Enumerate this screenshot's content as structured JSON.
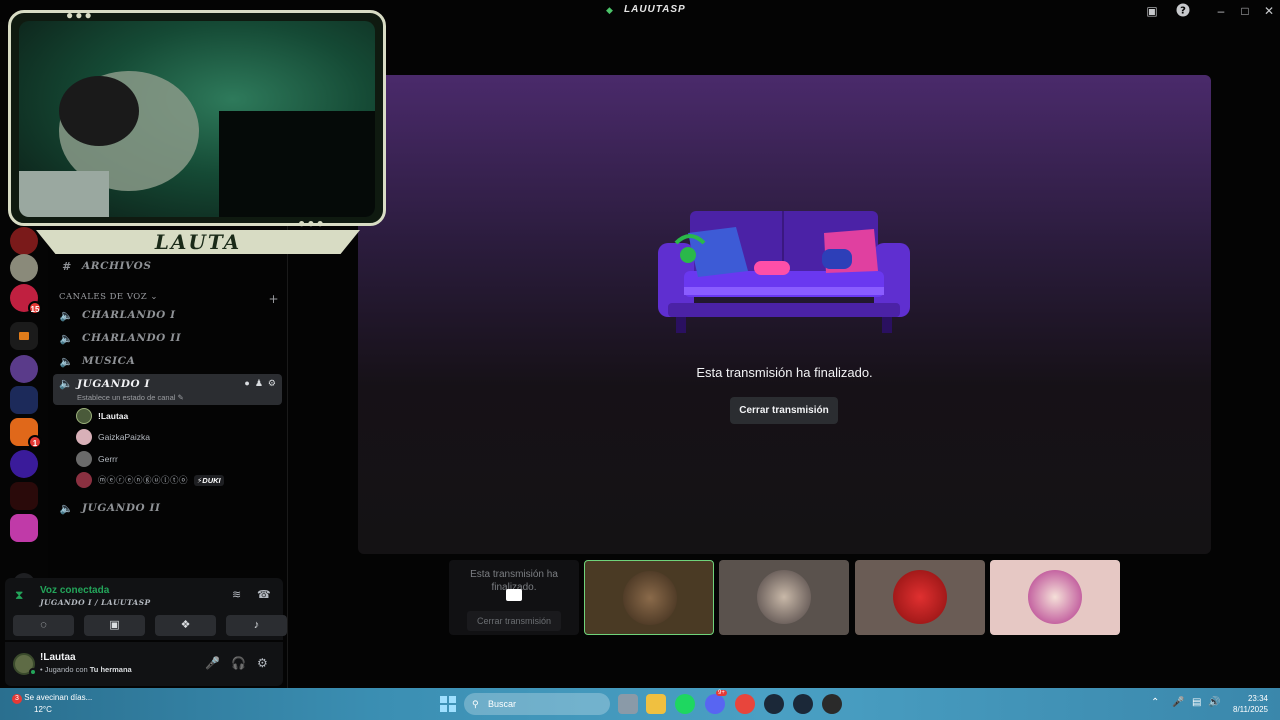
{
  "window": {
    "title": "LAUUTASP"
  },
  "webcam": {
    "name": "LAUTA"
  },
  "sidebar": {
    "top_channel": "ARCHIVOS",
    "voice_section": "CANALES DE VOZ",
    "voice_channels": [
      "CHARLANDO I",
      "CHARLANDO II",
      "MUSICA"
    ],
    "active_channel": {
      "name": "JUGANDO I",
      "status": "Establece un estado de canal"
    },
    "members": [
      "!Lautaa",
      "GaizkaPaizka",
      "Gerrr",
      "ⓜⓔⓡⓔⓝⓖⓤⓛⓣⓞ"
    ],
    "member_tag": "⚡DUKI",
    "other_channel": "JUGANDO II"
  },
  "server_badges": [
    "15",
    "1"
  ],
  "voice": {
    "title": "Voz conectada",
    "subtitle": "JUGANDO I / LAUUTASP"
  },
  "user": {
    "name": "!Lautaa",
    "status_prefix": "• Jugando con ",
    "status_game": "Tu hermana"
  },
  "stage": {
    "message": "Esta transmisión ha finalizado.",
    "close_button": "Cerrar transmisión"
  },
  "tiles": {
    "self_message": "Esta transmisión ha finalizado.",
    "self_button": "Cerrar transmisión"
  },
  "taskbar": {
    "weather_title": "Se avecinan días...",
    "weather_temp": "12°C",
    "weather_badge": "3",
    "search_placeholder": "Buscar",
    "discord_badge": "9+",
    "time": "23:34",
    "date": "8/11/2025"
  },
  "colors": {
    "accent_green": "#23a55a",
    "stage_top": "#4a2a6b",
    "badge_red": "#e53935"
  }
}
